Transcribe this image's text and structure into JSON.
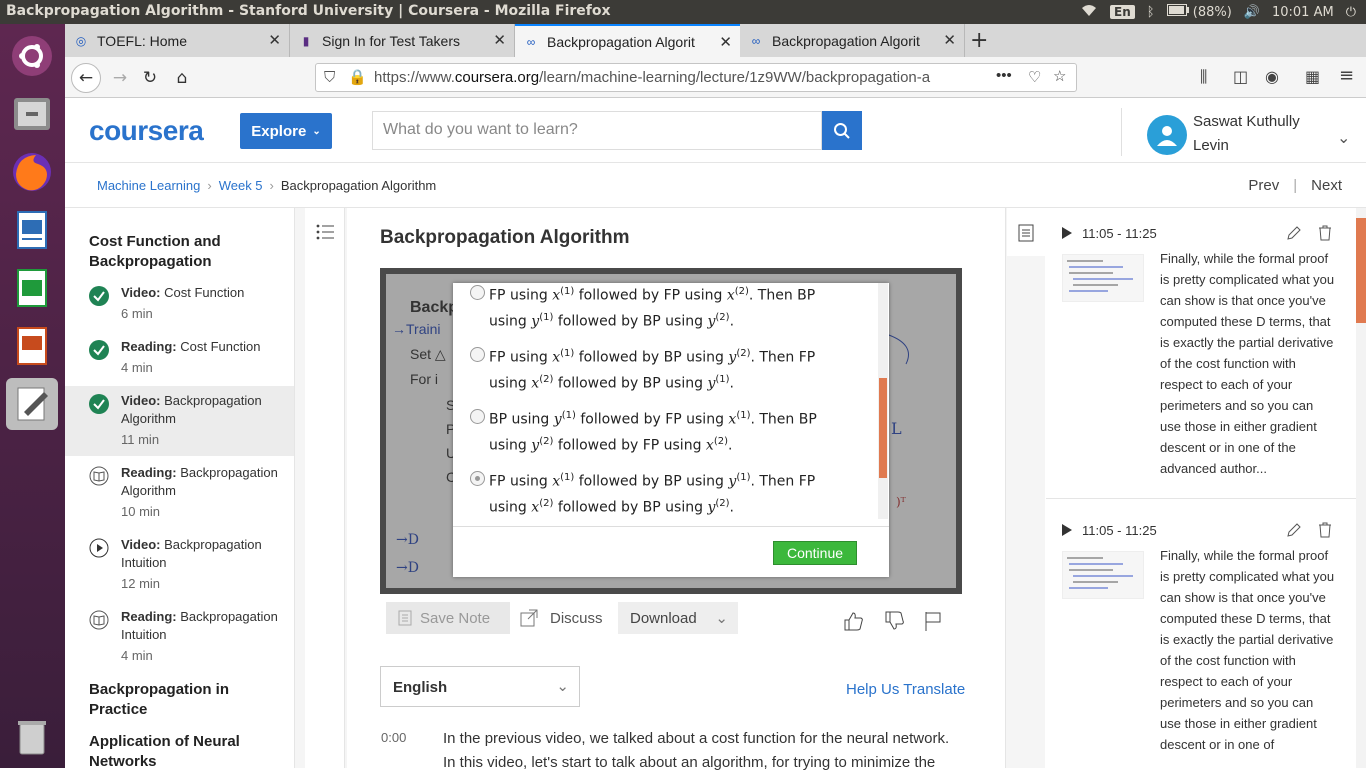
{
  "os": {
    "window_title": "Backpropagation Algorithm - Stanford University | Coursera - Mozilla Firefox",
    "lang": "En",
    "battery": "(88%)",
    "clock": "10:01 AM"
  },
  "launcher": {
    "items": [
      "ubuntu-icon",
      "files-icon",
      "firefox-icon",
      "writer-icon",
      "calc-icon",
      "impress-icon",
      "text-editor-icon",
      "trash-icon"
    ]
  },
  "browser": {
    "tabs": [
      {
        "label": "TOEFL: Home",
        "close": "✕"
      },
      {
        "label": "Sign In for Test Takers",
        "close": "✕"
      },
      {
        "label": "Backpropagation Algorit",
        "close": "✕"
      },
      {
        "label": "Backpropagation Algorit",
        "close": "✕"
      }
    ],
    "new_tab": "+",
    "url_prefix": "https://www.",
    "url_domain": "coursera.org",
    "url_rest": "/learn/machine-learning/lecture/1z9WW/backpropagation-a",
    "url_more": "•••"
  },
  "header": {
    "logo": "coursera",
    "explore": "Explore",
    "search_placeholder": "What do you want to learn?",
    "user_name": "Saswat Kuthully Levin"
  },
  "breadcrumb": {
    "items": [
      "Machine Learning",
      "Week 5",
      "Backpropagation Algorithm"
    ],
    "prev": "Prev",
    "next": "Next"
  },
  "sidebar": {
    "section1": "Cost Function and Backpropagation",
    "items": [
      {
        "type": "Video:",
        "title": "Cost Function",
        "duration": "6 min",
        "status": "done"
      },
      {
        "type": "Reading:",
        "title": "Cost Function",
        "duration": "4 min",
        "status": "done"
      },
      {
        "type": "Video:",
        "title": "Backpropagation Algorithm",
        "duration": "11 min",
        "status": "done"
      },
      {
        "type": "Reading:",
        "title": "Backpropagation Algorithm",
        "duration": "10 min",
        "status": "reading"
      },
      {
        "type": "Video:",
        "title": "Backpropagation Intuition",
        "duration": "12 min",
        "status": "video"
      },
      {
        "type": "Reading:",
        "title": "Backpropagation Intuition",
        "duration": "4 min",
        "status": "reading"
      }
    ],
    "section2": "Backpropagation in Practice",
    "section3": "Application of Neural Networks"
  },
  "lecture": {
    "title": "Backpropagation Algorithm",
    "quiz": {
      "options": [
        {
          "a1": "FP using",
          "v1": "x",
          "s1": "(1)",
          "a2": "followed by FP using",
          "v2": "x",
          "s2": "(2)",
          "a3": ". Then BP",
          "b1": "using",
          "v3": "y",
          "s3": "(1)",
          "b2": "followed by BP using",
          "v4": "y",
          "s4": "(2)",
          "b3": ".",
          "selected": false
        },
        {
          "a1": "FP using",
          "v1": "x",
          "s1": "(1)",
          "a2": "followed by BP using",
          "v2": "y",
          "s2": "(2)",
          "a3": ". Then FP",
          "b1": "using",
          "v3": "x",
          "s3": "(2)",
          "b2": "followed by BP using",
          "v4": "y",
          "s4": "(1)",
          "b3": ".",
          "selected": false
        },
        {
          "a1": "BP using",
          "v1": "y",
          "s1": "(1)",
          "a2": "followed by FP using",
          "v2": "x",
          "s2": "(1)",
          "a3": ". Then BP",
          "b1": "using",
          "v3": "y",
          "s3": "(2)",
          "b2": "followed by FP using",
          "v4": "x",
          "s4": "(2)",
          "b3": ".",
          "selected": false
        },
        {
          "a1": "FP using",
          "v1": "x",
          "s1": "(1)",
          "a2": "followed by BP using",
          "v2": "y",
          "s2": "(1)",
          "a3": ". Then FP",
          "b1": "using",
          "v3": "x",
          "s3": "(2)",
          "b2": "followed by BP using",
          "v4": "y",
          "s4": "(2)",
          "b3": ".",
          "selected": true
        }
      ],
      "continue": "Continue"
    },
    "tools": {
      "save_note": "Save Note",
      "discuss": "Discuss",
      "download": "Download"
    },
    "language": "English",
    "help_translate": "Help Us Translate",
    "transcript": {
      "time": "0:00",
      "text": "In the previous video, we talked about a cost function for the neural network. In this video, let's start to talk about an algorithm, for trying to minimize the"
    }
  },
  "notes": [
    {
      "time": "11:05 - 11:25",
      "text": "Finally, while the formal proof is pretty complicated what you can show is that once you've computed these D terms, that is exactly the partial derivative of the cost function with respect to each of your perimeters and so you can use those in either gradient descent or in one of the advanced author..."
    },
    {
      "time": "11:05 - 11:25",
      "text": "Finally, while the formal proof is pretty complicated what you can show is that once you've computed these D terms, that is exactly the partial derivative of the cost function with respect to each of your perimeters and so you can use those in either gradient descent or in one of"
    }
  ],
  "colors": {
    "coursera_blue": "#2a73cc",
    "done_green": "#1f8354",
    "continue_green": "#3cb83c",
    "scroll_orange": "#e07a50"
  }
}
